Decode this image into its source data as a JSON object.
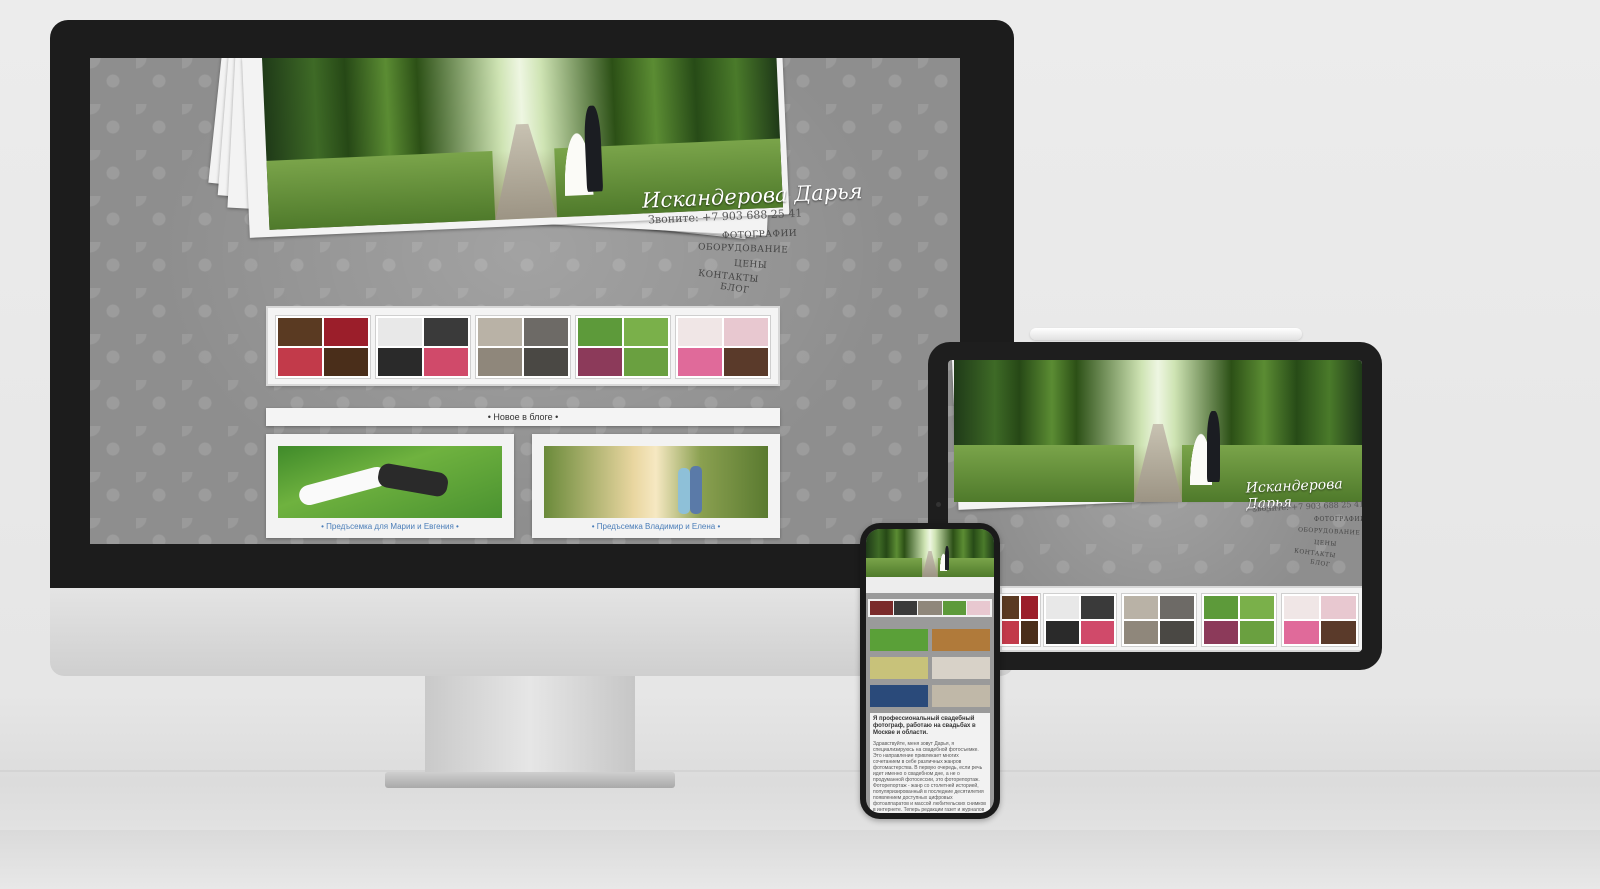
{
  "site": {
    "signature": "Искандерова Дарья",
    "phone": "Звоните: +7 903 688 25 41",
    "menu": [
      "ФОТОГРАФИИ",
      "ОБОРУДОВАНИЕ",
      "ЦЕНЫ",
      "КОНТАКТЫ",
      "БЛОГ"
    ],
    "blog_heading": "• Новое в блоге •",
    "posts": [
      {
        "caption": "• Предъсемка для Марии и Евгения •"
      },
      {
        "caption": "• Предъсемка Владимир и Елена •"
      }
    ],
    "mobile_intro": "Я профессиональный свадебный фотограф, работаю на свадьбах в Москве и области.",
    "mobile_body": "Здравствуйте, меня зовут Дарья, я специализируюсь на свадебной фотосъемке. Это направление привлекает многих сочетанием в себе различных жанров фотомастерства. В первую очередь, если речь идет именно о свадебном дне, а не о продуманной фотосессии, это фоторепортаж. Фоторепортаж - жанр со столетней историей, популяризированный в последние десятилетия появлением доступных цифровых фотоаппаратов и массой любительских снимков в интернете. Теперь редакции газет и журналов предпочитают экономить на фотокорреспонденте, используя бильд-редактора выбирающего кадры из ленты, в фотобанке. Чем этот жанр. Хорошо еще, что мастера"
  },
  "colors": {
    "background": "#e9e9e9",
    "bezel": "#1c1c1c",
    "site_pattern": "#8e8e8e",
    "caption_link": "#4a7db8"
  }
}
